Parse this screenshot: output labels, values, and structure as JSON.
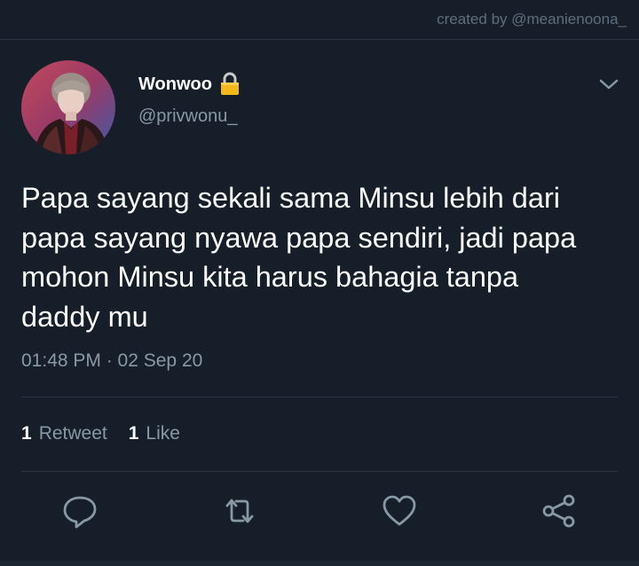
{
  "header": {
    "credit": "created by @meanienoona_"
  },
  "tweet": {
    "display_name": "Wonwoo",
    "handle": "@privwonu_",
    "lines": [
      "Papa sayang sekali sama Minsu lebih dari",
      "papa sayang nyawa papa sendiri, jadi papa",
      "mohon Minsu kita harus bahagia tanpa",
      "daddy mu"
    ],
    "timestamp": "01:48 PM · 02 Sep 20",
    "retweets": {
      "count": "1",
      "label": "Retweet"
    },
    "likes": {
      "count": "1",
      "label": "Like"
    }
  },
  "icons": {
    "lock": "lock-icon",
    "chevron": "chevron-down-icon",
    "reply": "reply-icon",
    "retweet": "retweet-icon",
    "like": "heart-icon",
    "share": "share-icon"
  },
  "colors": {
    "background": "#151e29",
    "text_primary": "#ffffff",
    "text_secondary": "#8899a6",
    "divider": "#2b3644",
    "lock": "#f5b81c"
  }
}
